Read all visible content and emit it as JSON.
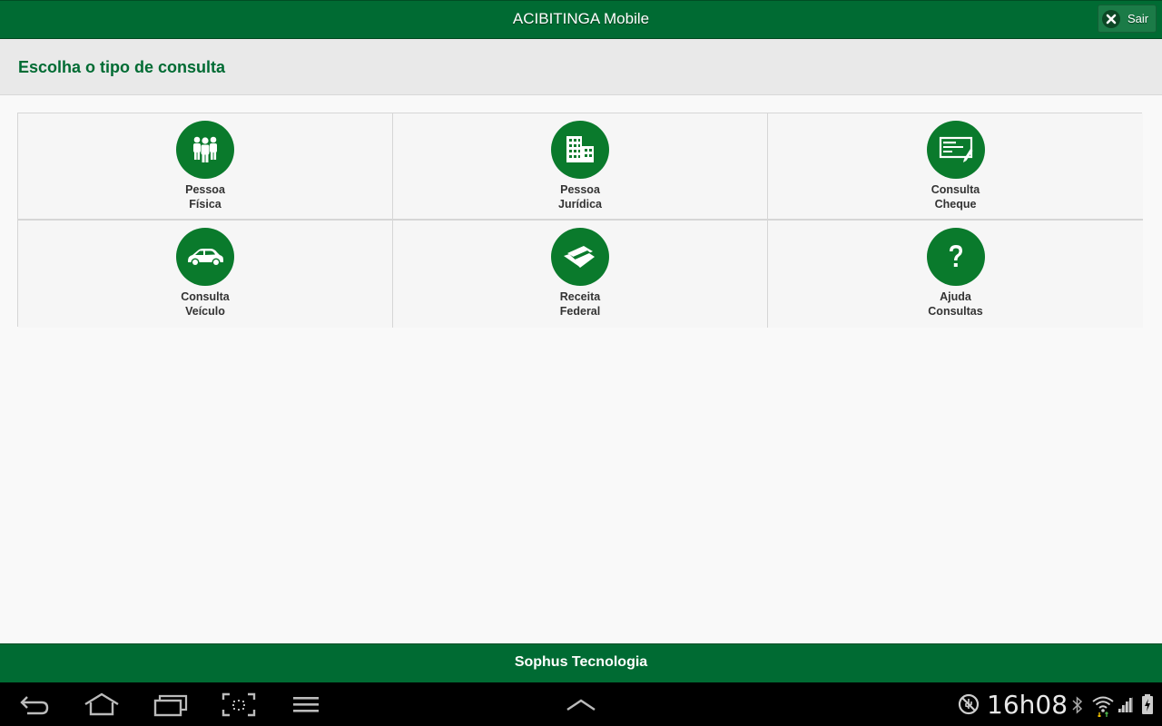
{
  "header": {
    "title": "ACIBITINGA Mobile",
    "exit_label": "Sair"
  },
  "subheader": {
    "title": "Escolha o tipo de consulta"
  },
  "tiles": [
    {
      "line1": "Pessoa",
      "line2": "Física",
      "icon": "people-icon"
    },
    {
      "line1": "Pessoa",
      "line2": "Jurídica",
      "icon": "buildings-icon"
    },
    {
      "line1": "Consulta",
      "line2": "Cheque",
      "icon": "check-icon"
    },
    {
      "line1": "Consulta",
      "line2": "Veículo",
      "icon": "car-icon"
    },
    {
      "line1": "Receita",
      "line2": "Federal",
      "icon": "receita-federal-icon"
    },
    {
      "line1": "Ajuda",
      "line2": "Consultas",
      "icon": "question-icon"
    }
  ],
  "footer": {
    "text": "Sophus Tecnologia"
  },
  "system_bar": {
    "clock": "16h08"
  },
  "colors": {
    "brand_green": "#006b33",
    "icon_green": "#0a7a2c",
    "title_green": "#006b33"
  }
}
